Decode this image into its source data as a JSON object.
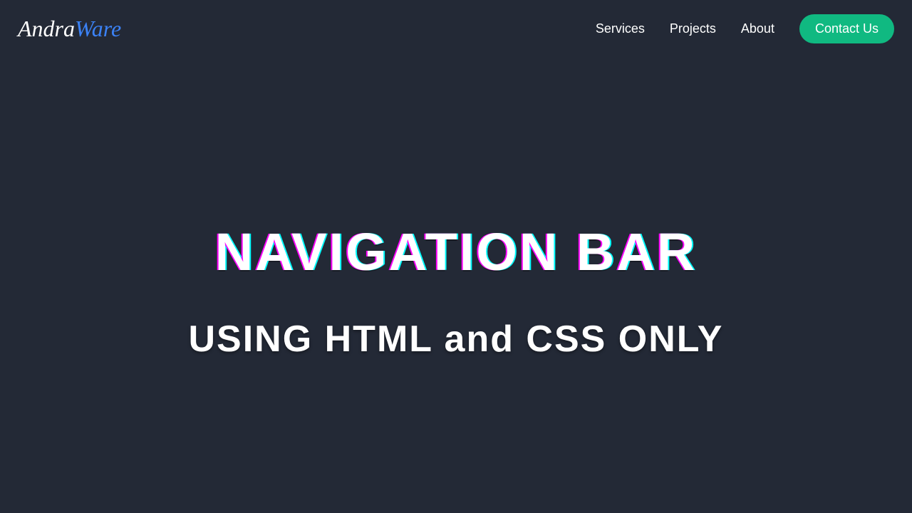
{
  "logo": {
    "first": "Andra",
    "second": "Ware"
  },
  "nav": {
    "services": "Services",
    "projects": "Projects",
    "about": "About",
    "contact": "Contact Us"
  },
  "hero": {
    "title": "NAVIGATION BAR",
    "subtitle": "USING HTML and CSS ONLY"
  },
  "colors": {
    "background": "#232936",
    "accent_blue": "#3b82f6",
    "accent_green": "#10b981",
    "text": "#ffffff"
  }
}
